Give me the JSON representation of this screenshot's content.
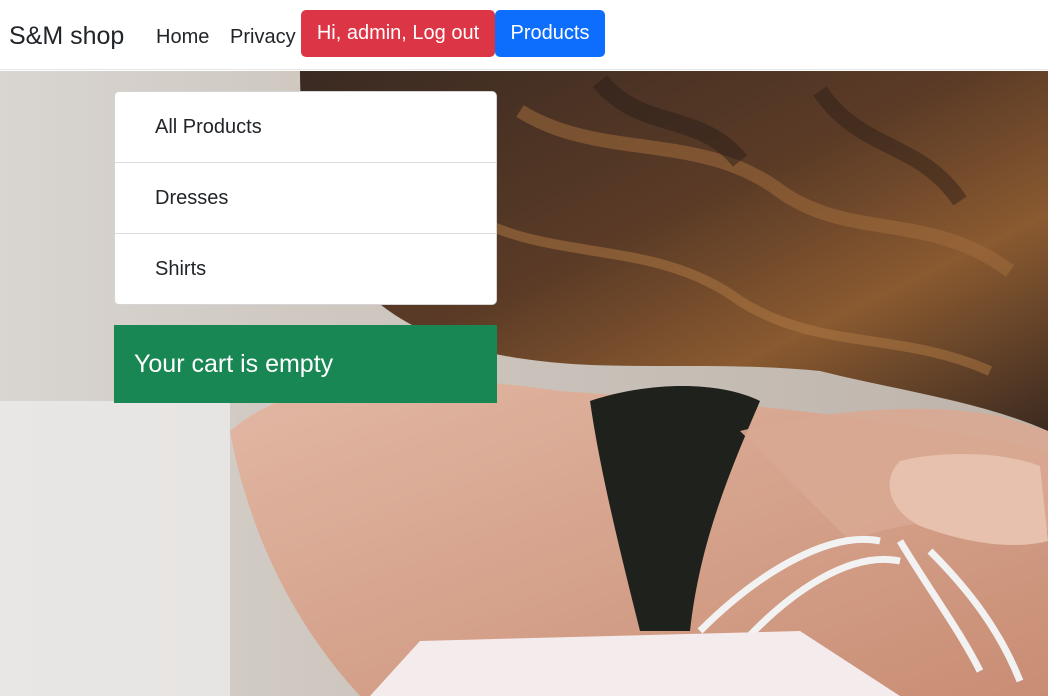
{
  "navbar": {
    "brand": "S&M shop",
    "links": [
      {
        "label": "Home"
      },
      {
        "label": "Privacy"
      }
    ],
    "logout_button": {
      "label": "Hi, admin, Log out",
      "color": "#dc3545"
    },
    "products_button": {
      "label": "Products",
      "color": "#0d6efd"
    }
  },
  "products_menu": {
    "items": [
      {
        "label": "All Products"
      },
      {
        "label": "Dresses"
      },
      {
        "label": "Shirts"
      }
    ]
  },
  "cart": {
    "message": "Your cart is empty",
    "color": "#198754"
  },
  "hero": {
    "image_subject": "woman-with-shopping-bags-photo"
  }
}
